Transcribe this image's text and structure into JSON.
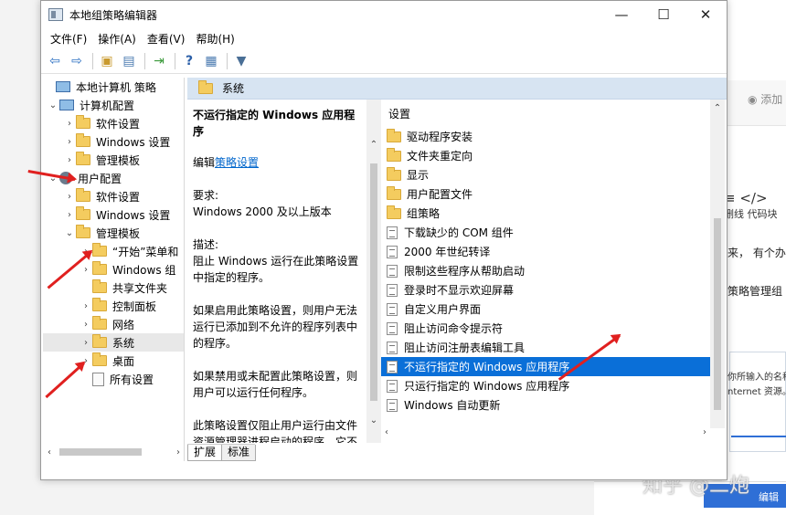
{
  "window": {
    "title": "本地组策略编辑器",
    "minimize": "—",
    "maximize": "☐",
    "close": "✕"
  },
  "menu": [
    "文件(F)",
    "操作(A)",
    "查看(V)",
    "帮助(H)"
  ],
  "tree": {
    "items": [
      {
        "label": "本地计算机 策略",
        "icon": "pc-icon"
      },
      {
        "label": "计算机配置",
        "icon": "pc-icon"
      },
      {
        "label": "软件设置",
        "icon": "folder-icon"
      },
      {
        "label": "Windows 设置",
        "icon": "folder-icon"
      },
      {
        "label": "管理模板",
        "icon": "folder-icon"
      },
      {
        "label": "用户配置",
        "icon": "user-icon"
      },
      {
        "label": "软件设置",
        "icon": "folder-icon"
      },
      {
        "label": "Windows 设置",
        "icon": "folder-icon"
      },
      {
        "label": "管理模板",
        "icon": "folder-icon"
      },
      {
        "label": "“开始”菜单和",
        "icon": "folder-icon"
      },
      {
        "label": "Windows 组",
        "icon": "folder-icon"
      },
      {
        "label": "共享文件夹",
        "icon": "folder-icon"
      },
      {
        "label": "控制面板",
        "icon": "folder-icon"
      },
      {
        "label": "网络",
        "icon": "folder-icon"
      },
      {
        "label": "系统",
        "icon": "folder-icon"
      },
      {
        "label": "桌面",
        "icon": "folder-icon"
      },
      {
        "label": "所有设置",
        "icon": "document-icon"
      }
    ]
  },
  "right_pane": {
    "header": "系统",
    "description": {
      "title": "不运行指定的 Windows 应用程序",
      "edit_prefix": "编辑",
      "edit_link": "策略设置",
      "requirements_label": "要求:",
      "requirements": "Windows 2000 及以上版本",
      "desc_label": "描述:",
      "desc": "阻止 Windows 运行在此策略设置中指定的程序。",
      "enabled": "如果启用此策略设置，则用户无法运行已添加到不允许的程序列表中的程序。",
      "disabled": "如果禁用或未配置此策略设置，则用户可以运行任何程序。",
      "note": "此策略设置仅阻止用户运行由文件资源管理器进程启动的程序。它不会阻止用户运行由系统进程或其他进程启动的程序，如任务管理器"
    },
    "list_header": "设置",
    "items": [
      {
        "label": "驱动程序安装",
        "type": "folder"
      },
      {
        "label": "文件夹重定向",
        "type": "folder"
      },
      {
        "label": "显示",
        "type": "folder"
      },
      {
        "label": "用户配置文件",
        "type": "folder"
      },
      {
        "label": "组策略",
        "type": "folder"
      },
      {
        "label": "下载缺少的 COM 组件",
        "type": "setting"
      },
      {
        "label": "2000 年世纪转译",
        "type": "setting"
      },
      {
        "label": "限制这些程序从帮助启动",
        "type": "setting"
      },
      {
        "label": "登录时不显示欢迎屏幕",
        "type": "setting"
      },
      {
        "label": "自定义用户界面",
        "type": "setting"
      },
      {
        "label": "阻止访问命令提示符",
        "type": "setting"
      },
      {
        "label": "阻止访问注册表编辑工具",
        "type": "setting"
      },
      {
        "label": "不运行指定的 Windows 应用程序",
        "type": "setting",
        "selected": true
      },
      {
        "label": "只运行指定的 Windows 应用程序",
        "type": "setting"
      },
      {
        "label": "Windows 自动更新",
        "type": "setting"
      }
    ],
    "tabs": [
      "扩展",
      "标准"
    ]
  },
  "background": {
    "add": "添加",
    "tools": "删线   代码块",
    "line1": "来，  有个办",
    "line2": "策略管理组",
    "box_t1": "你所输入的名称",
    "box_t2": "nternet 资源。",
    "watermark": "知乎 @二炮",
    "button": "编辑"
  },
  "colors": {
    "selection": "#0a6fd8",
    "header_bg": "#d7e4f2",
    "arrow": "#e0201f",
    "link": "#0066cc"
  }
}
